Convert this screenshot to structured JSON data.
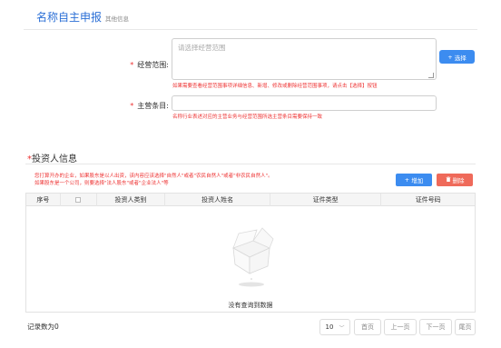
{
  "header": {
    "title": "名称自主申报",
    "subtitle": "其他信息"
  },
  "business_scope": {
    "required_mark": "*",
    "label": "经营范围:",
    "placeholder": "请选择经营范围",
    "hint": "如果需要查看经营范围事项详细信息、新增、修改或删除经营范围事项，请点击【选择】按钮",
    "select_button": "选择",
    "select_icon": "plus-icon"
  },
  "main_item": {
    "required_mark": "*",
    "label": "主营条目:",
    "hint": "名称行业表述对应的主营业务与经营范围所选主营条目需要保持一致"
  },
  "investors": {
    "required_mark": "*",
    "title": "投资人信息",
    "notes": [
      "您打算开办的企业，如果股东是以人出资，该内容应该选择\"自然人\"或者\"农民自然人\"或者\"非农民自然人\"。",
      "如果股东是一个公司，则要选择\"法人股东\"或者\"企业法人\"等"
    ],
    "add_button": "增加",
    "add_icon": "plus-icon",
    "delete_button": "删除",
    "delete_icon": "trash-icon",
    "columns": [
      "序号",
      "",
      "投资人类别",
      "投资人姓名",
      "证件类型",
      "证件号码"
    ],
    "empty_text": "没有查询到数据"
  },
  "footer": {
    "record_count": "记录数为0",
    "page_size": "10",
    "first": "首页",
    "prev": "上一页",
    "next": "下一页",
    "last": "尾页"
  },
  "colors": {
    "primary": "#3c8cf0",
    "danger": "#ef6a5a",
    "title": "#2b6fd6",
    "required": "#e33333"
  }
}
